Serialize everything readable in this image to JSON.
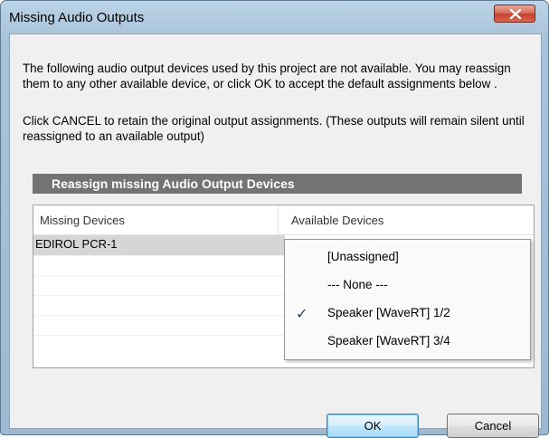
{
  "window": {
    "title": "Missing Audio Outputs"
  },
  "message": {
    "line1": "The following audio output devices used by this project are not available. You may reassign them to any other available device, or click OK to accept the default assignments below .",
    "line2": "Click CANCEL to retain the original output assignments. (These outputs will remain silent until reassigned to an available output)"
  },
  "section": {
    "header": "Reassign missing Audio Output Devices"
  },
  "table": {
    "columns": [
      "Missing Devices",
      "Available Devices"
    ],
    "rows": [
      {
        "missing_device": "EDIROL PCR-1"
      }
    ]
  },
  "dropdown": {
    "options": [
      {
        "label": "[Unassigned]",
        "checked": false
      },
      {
        "label": "--- None ---",
        "checked": false
      },
      {
        "label": "Speaker [WaveRT] 1/2",
        "checked": true
      },
      {
        "label": "Speaker [WaveRT] 3/4",
        "checked": false
      }
    ],
    "check_icon": "check-icon"
  },
  "buttons": {
    "ok_label": "OK",
    "cancel_label": "Cancel"
  }
}
